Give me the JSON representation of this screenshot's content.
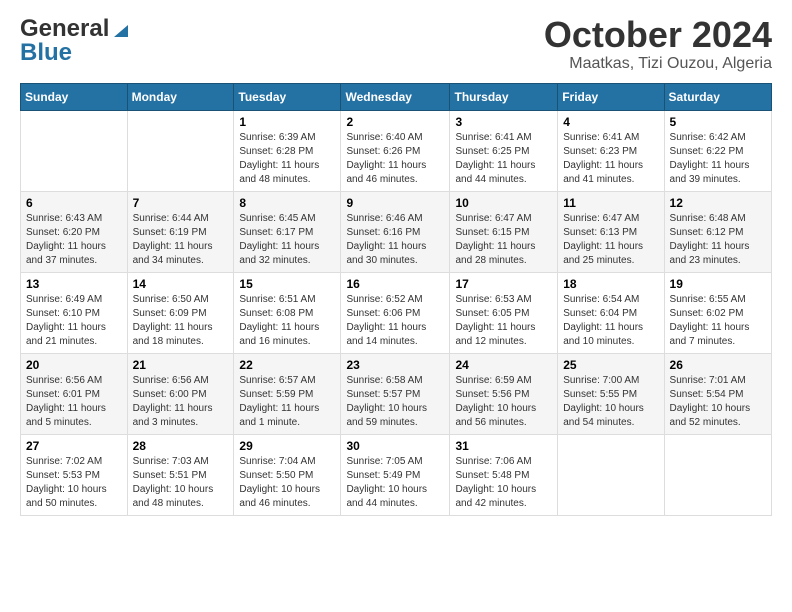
{
  "header": {
    "logo": {
      "general": "General",
      "blue": "Blue"
    },
    "month": "October 2024",
    "location": "Maatkas, Tizi Ouzou, Algeria"
  },
  "weekdays": [
    "Sunday",
    "Monday",
    "Tuesday",
    "Wednesday",
    "Thursday",
    "Friday",
    "Saturday"
  ],
  "weeks": [
    [
      {
        "day": "",
        "info": ""
      },
      {
        "day": "",
        "info": ""
      },
      {
        "day": "1",
        "info": "Sunrise: 6:39 AM\nSunset: 6:28 PM\nDaylight: 11 hours and 48 minutes."
      },
      {
        "day": "2",
        "info": "Sunrise: 6:40 AM\nSunset: 6:26 PM\nDaylight: 11 hours and 46 minutes."
      },
      {
        "day": "3",
        "info": "Sunrise: 6:41 AM\nSunset: 6:25 PM\nDaylight: 11 hours and 44 minutes."
      },
      {
        "day": "4",
        "info": "Sunrise: 6:41 AM\nSunset: 6:23 PM\nDaylight: 11 hours and 41 minutes."
      },
      {
        "day": "5",
        "info": "Sunrise: 6:42 AM\nSunset: 6:22 PM\nDaylight: 11 hours and 39 minutes."
      }
    ],
    [
      {
        "day": "6",
        "info": "Sunrise: 6:43 AM\nSunset: 6:20 PM\nDaylight: 11 hours and 37 minutes."
      },
      {
        "day": "7",
        "info": "Sunrise: 6:44 AM\nSunset: 6:19 PM\nDaylight: 11 hours and 34 minutes."
      },
      {
        "day": "8",
        "info": "Sunrise: 6:45 AM\nSunset: 6:17 PM\nDaylight: 11 hours and 32 minutes."
      },
      {
        "day": "9",
        "info": "Sunrise: 6:46 AM\nSunset: 6:16 PM\nDaylight: 11 hours and 30 minutes."
      },
      {
        "day": "10",
        "info": "Sunrise: 6:47 AM\nSunset: 6:15 PM\nDaylight: 11 hours and 28 minutes."
      },
      {
        "day": "11",
        "info": "Sunrise: 6:47 AM\nSunset: 6:13 PM\nDaylight: 11 hours and 25 minutes."
      },
      {
        "day": "12",
        "info": "Sunrise: 6:48 AM\nSunset: 6:12 PM\nDaylight: 11 hours and 23 minutes."
      }
    ],
    [
      {
        "day": "13",
        "info": "Sunrise: 6:49 AM\nSunset: 6:10 PM\nDaylight: 11 hours and 21 minutes."
      },
      {
        "day": "14",
        "info": "Sunrise: 6:50 AM\nSunset: 6:09 PM\nDaylight: 11 hours and 18 minutes."
      },
      {
        "day": "15",
        "info": "Sunrise: 6:51 AM\nSunset: 6:08 PM\nDaylight: 11 hours and 16 minutes."
      },
      {
        "day": "16",
        "info": "Sunrise: 6:52 AM\nSunset: 6:06 PM\nDaylight: 11 hours and 14 minutes."
      },
      {
        "day": "17",
        "info": "Sunrise: 6:53 AM\nSunset: 6:05 PM\nDaylight: 11 hours and 12 minutes."
      },
      {
        "day": "18",
        "info": "Sunrise: 6:54 AM\nSunset: 6:04 PM\nDaylight: 11 hours and 10 minutes."
      },
      {
        "day": "19",
        "info": "Sunrise: 6:55 AM\nSunset: 6:02 PM\nDaylight: 11 hours and 7 minutes."
      }
    ],
    [
      {
        "day": "20",
        "info": "Sunrise: 6:56 AM\nSunset: 6:01 PM\nDaylight: 11 hours and 5 minutes."
      },
      {
        "day": "21",
        "info": "Sunrise: 6:56 AM\nSunset: 6:00 PM\nDaylight: 11 hours and 3 minutes."
      },
      {
        "day": "22",
        "info": "Sunrise: 6:57 AM\nSunset: 5:59 PM\nDaylight: 11 hours and 1 minute."
      },
      {
        "day": "23",
        "info": "Sunrise: 6:58 AM\nSunset: 5:57 PM\nDaylight: 10 hours and 59 minutes."
      },
      {
        "day": "24",
        "info": "Sunrise: 6:59 AM\nSunset: 5:56 PM\nDaylight: 10 hours and 56 minutes."
      },
      {
        "day": "25",
        "info": "Sunrise: 7:00 AM\nSunset: 5:55 PM\nDaylight: 10 hours and 54 minutes."
      },
      {
        "day": "26",
        "info": "Sunrise: 7:01 AM\nSunset: 5:54 PM\nDaylight: 10 hours and 52 minutes."
      }
    ],
    [
      {
        "day": "27",
        "info": "Sunrise: 7:02 AM\nSunset: 5:53 PM\nDaylight: 10 hours and 50 minutes."
      },
      {
        "day": "28",
        "info": "Sunrise: 7:03 AM\nSunset: 5:51 PM\nDaylight: 10 hours and 48 minutes."
      },
      {
        "day": "29",
        "info": "Sunrise: 7:04 AM\nSunset: 5:50 PM\nDaylight: 10 hours and 46 minutes."
      },
      {
        "day": "30",
        "info": "Sunrise: 7:05 AM\nSunset: 5:49 PM\nDaylight: 10 hours and 44 minutes."
      },
      {
        "day": "31",
        "info": "Sunrise: 7:06 AM\nSunset: 5:48 PM\nDaylight: 10 hours and 42 minutes."
      },
      {
        "day": "",
        "info": ""
      },
      {
        "day": "",
        "info": ""
      }
    ]
  ]
}
